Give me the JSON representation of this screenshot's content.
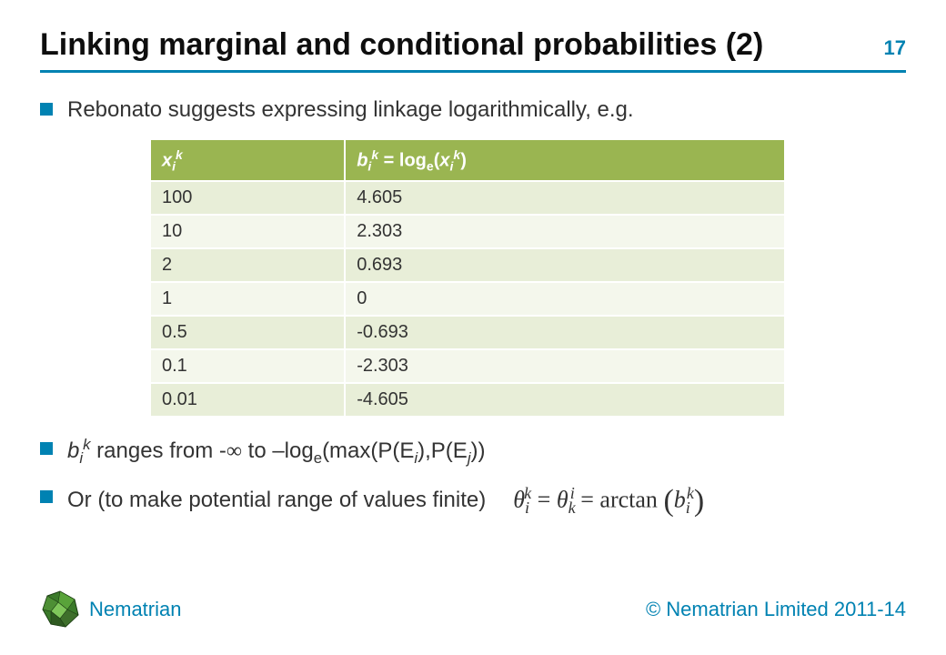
{
  "page_number": "17",
  "title": "Linking marginal and conditional probabilities (2)",
  "bullets": {
    "rebonato": "Rebonato suggests expressing linkage logarithmically, e.g.",
    "range_pre": "b",
    "range_sub": "i",
    "range_sup": "k",
    "range_mid": "  ranges from -",
    "range_inf": "∞",
    "range_after_inf": " to –log",
    "range_e": "e",
    "range_paren": "(max(P(E",
    "range_Ei_i": "i",
    "range_comma": "),P(E",
    "range_Ej_j": "j",
    "range_close": "))",
    "finite": "Or (to make potential range of values finite)"
  },
  "formula": {
    "theta": "θ",
    "i": "i",
    "k": "k",
    "eq": " = ",
    "arctan": "arctan",
    "b": "b"
  },
  "chart_data": {
    "type": "table",
    "title": "Logarithmic linkage values",
    "headers": {
      "col1_var": "x",
      "col1_sub": "i",
      "col1_sup": "k",
      "col2_var_b": "b",
      "col2_sub": "i",
      "col2_sup": "k",
      "col2_mid": " = log",
      "col2_e": "e",
      "col2_open": "(",
      "col2_var_x": "x",
      "col2_close": ")"
    },
    "rows": [
      {
        "x": "100",
        "b": "4.605"
      },
      {
        "x": "10",
        "b": "2.303"
      },
      {
        "x": "2",
        "b": "0.693"
      },
      {
        "x": "1",
        "b": "0"
      },
      {
        "x": "0.5",
        "b": "-0.693"
      },
      {
        "x": "0.1",
        "b": "-2.303"
      },
      {
        "x": "0.01",
        "b": "-4.605"
      }
    ]
  },
  "footer": {
    "brand": "Nematrian",
    "copyright": "© Nematrian Limited 2011-14"
  }
}
